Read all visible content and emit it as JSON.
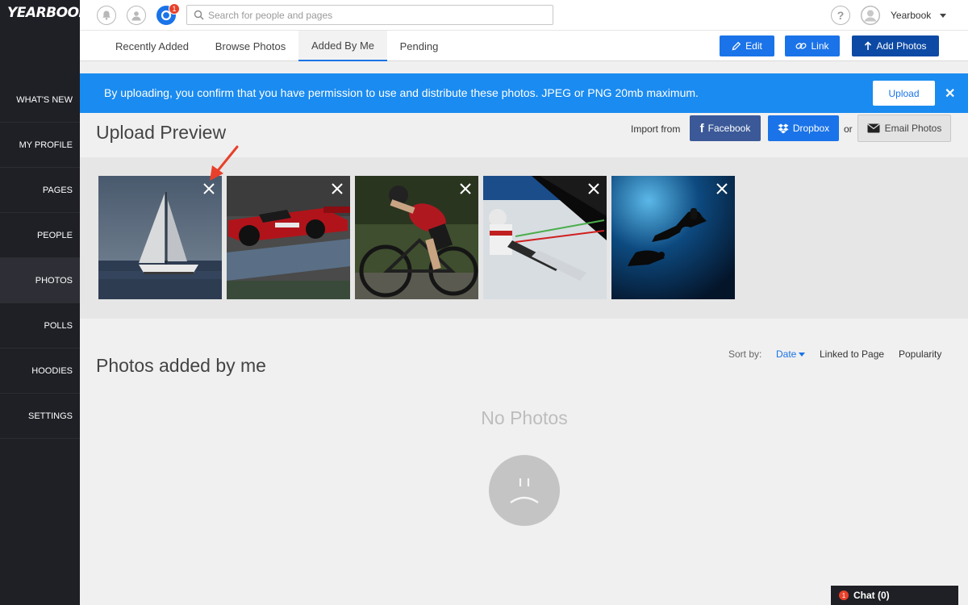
{
  "app": {
    "logo": "YEARBOOK"
  },
  "topbar": {
    "search_placeholder": "Search for people and pages",
    "notification_count": "1",
    "user_name": "Yearbook"
  },
  "sidebar": {
    "items": [
      {
        "label": "WHAT'S NEW"
      },
      {
        "label": "MY PROFILE"
      },
      {
        "label": "PAGES"
      },
      {
        "label": "PEOPLE"
      },
      {
        "label": "PHOTOS",
        "active": true
      },
      {
        "label": "POLLS"
      },
      {
        "label": "HOODIES"
      },
      {
        "label": "SETTINGS"
      }
    ]
  },
  "tabs": [
    {
      "label": "Recently Added"
    },
    {
      "label": "Browse Photos"
    },
    {
      "label": "Added By Me",
      "active": true
    },
    {
      "label": "Pending"
    }
  ],
  "actions": {
    "edit": "Edit",
    "link": "Link",
    "add_photos": "Add Photos"
  },
  "banner": {
    "text": "By uploading, you confirm that you have permission to use and distribute these photos. JPEG or PNG 20mb maximum.",
    "upload_label": "Upload"
  },
  "upload_preview": {
    "title": "Upload Preview",
    "import_label": "Import from",
    "facebook": "Facebook",
    "dropbox": "Dropbox",
    "or": "or",
    "email": "Email Photos",
    "photos": [
      {
        "name": "sailboat"
      },
      {
        "name": "race-car"
      },
      {
        "name": "cyclist"
      },
      {
        "name": "skier"
      },
      {
        "name": "scuba-divers"
      }
    ]
  },
  "my_photos": {
    "title": "Photos added by me",
    "sort_label": "Sort by:",
    "sort_options": [
      "Date",
      "Linked to Page",
      "Popularity"
    ],
    "sort_active": "Date",
    "empty_text": "No Photos"
  },
  "chat": {
    "label": "Chat (0)",
    "badge": "1"
  },
  "colors": {
    "accent": "#1a73e8",
    "banner": "#1a8bf0",
    "sidebar": "#1f2026",
    "facebook": "#3b5998",
    "navy_button": "#0d4aa5",
    "badge": "#e8402a",
    "annotation_arrow": "#e8402a"
  }
}
